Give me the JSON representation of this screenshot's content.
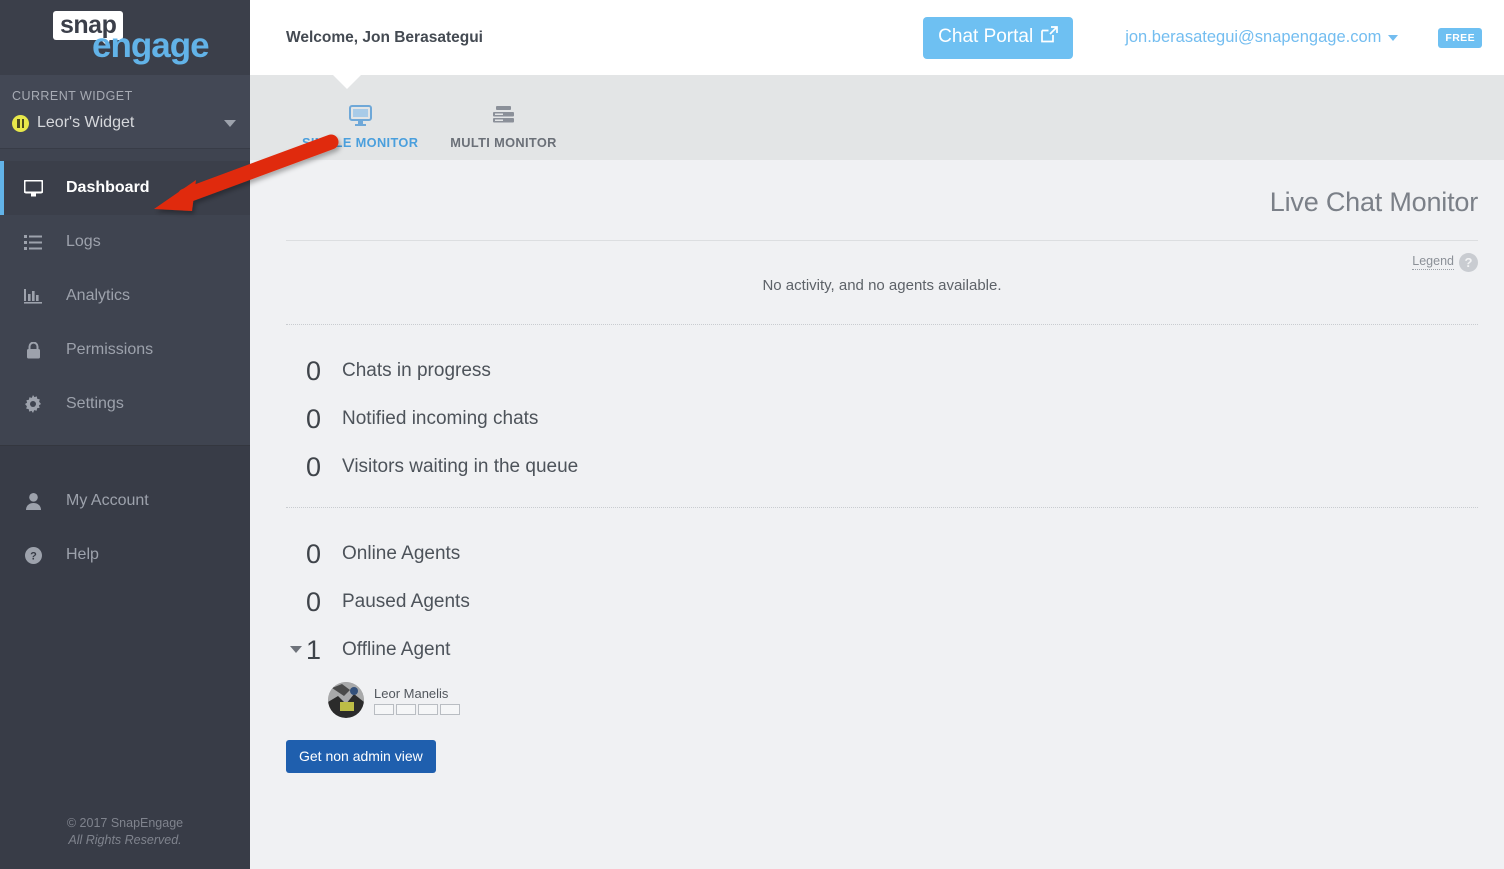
{
  "sidebar": {
    "logo": {
      "part1": "snap",
      "part2": "engage"
    },
    "widget_section_label": "CURRENT WIDGET",
    "widget_name": "Leor's Widget",
    "widget_status_icon": "pause-circle-icon",
    "primary_nav": [
      {
        "label": "Dashboard",
        "icon": "monitor-icon",
        "active": true
      },
      {
        "label": "Logs",
        "icon": "list-icon",
        "active": false
      },
      {
        "label": "Analytics",
        "icon": "bar-chart-icon",
        "active": false
      },
      {
        "label": "Permissions",
        "icon": "lock-icon",
        "active": false
      },
      {
        "label": "Settings",
        "icon": "gear-icon",
        "active": false
      }
    ],
    "secondary_nav": [
      {
        "label": "My Account",
        "icon": "user-icon"
      },
      {
        "label": "Help",
        "icon": "question-circle-icon"
      }
    ],
    "footer_line1": "© 2017 SnapEngage",
    "footer_line2": "All Rights Reserved."
  },
  "header": {
    "welcome": "Welcome, Jon Berasategui",
    "chat_portal_label": "Chat Portal",
    "chat_portal_icon": "external-link-icon",
    "account_email": "jon.berasategui@snapengage.com",
    "plan_badge": "FREE"
  },
  "tabs": [
    {
      "label": "SINGLE MONITOR",
      "icon": "single-monitor-icon",
      "active": true
    },
    {
      "label": "MULTI MONITOR",
      "icon": "multi-monitor-icon",
      "active": false
    }
  ],
  "main": {
    "page_title": "Live Chat Monitor",
    "legend_label": "Legend",
    "legend_icon": "question-mark-icon",
    "activity_message": "No activity, and no agents available.",
    "chat_stats": [
      {
        "count": "0",
        "label": "Chats in progress"
      },
      {
        "count": "0",
        "label": "Notified incoming chats"
      },
      {
        "count": "0",
        "label": "Visitors waiting in the queue"
      }
    ],
    "agent_stats": [
      {
        "count": "0",
        "label": "Online Agents",
        "expandable": false
      },
      {
        "count": "0",
        "label": "Paused Agents",
        "expandable": false
      },
      {
        "count": "1",
        "label": "Offline Agent",
        "expandable": true
      }
    ],
    "offline_agents": [
      {
        "name": "Leor Manelis",
        "slots": 4
      }
    ],
    "admin_button_label": "Get non admin view"
  },
  "annotation": {
    "type": "red-arrow",
    "points_to": "Dashboard",
    "color": "#e02b0c"
  },
  "colors": {
    "sidebar_bg": "#3b3f4a",
    "accent_blue": "#62b3e8",
    "button_blue": "#1f5fae",
    "tab_bg": "#e3e5e6",
    "content_bg": "#f0f1f3"
  }
}
